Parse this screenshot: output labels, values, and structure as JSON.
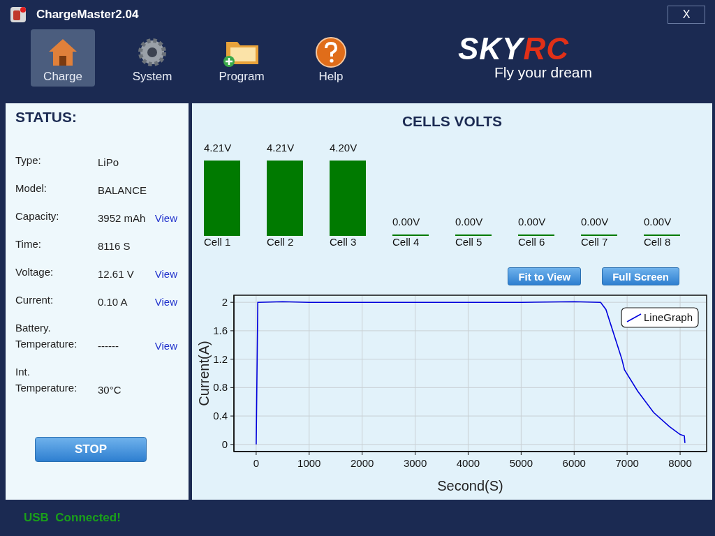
{
  "window": {
    "title": "ChargeMaster2.04",
    "close": "X"
  },
  "toolbar": [
    {
      "label": "Charge",
      "kind": "charge",
      "selected": true
    },
    {
      "label": "System",
      "kind": "system",
      "selected": false
    },
    {
      "label": "Program",
      "kind": "program",
      "selected": false
    },
    {
      "label": "Help",
      "kind": "help",
      "selected": false
    }
  ],
  "logo": {
    "primary": "SKY",
    "accent": "RC",
    "tagline": "Fly your dream"
  },
  "status": {
    "title": "STATUS:",
    "rows": [
      {
        "label": "Type:",
        "value": "LiPo"
      },
      {
        "label": "Model:",
        "value": "BALANCE"
      },
      {
        "label": "Capacity:",
        "value": "3952 mAh",
        "link": "View"
      },
      {
        "label": "Time:",
        "value": "8116 S"
      },
      {
        "label": "Voltage:",
        "value": "12.61 V",
        "link": "View"
      },
      {
        "label": "Current:",
        "value": "0.10 A",
        "link": "View"
      },
      {
        "label": "Battery.",
        "label2": "Temperature:",
        "value": "------",
        "link": "View"
      },
      {
        "label": "Int.",
        "label2": "Temperature:",
        "value": "30°C"
      }
    ],
    "stop_button": "STOP"
  },
  "cells": {
    "title": "CELLS VOLTS",
    "items": [
      {
        "name": "Cell 1",
        "reading": "4.21V",
        "kind": "full"
      },
      {
        "name": "Cell 2",
        "reading": "4.21V",
        "kind": "full"
      },
      {
        "name": "Cell 3",
        "reading": "4.20V",
        "kind": "full"
      },
      {
        "name": "Cell 4",
        "reading": "0.00V",
        "kind": "empty"
      },
      {
        "name": "Cell 5",
        "reading": "0.00V",
        "kind": "empty"
      },
      {
        "name": "Cell 6",
        "reading": "0.00V",
        "kind": "empty"
      },
      {
        "name": "Cell 7",
        "reading": "0.00V",
        "kind": "empty"
      },
      {
        "name": "Cell 8",
        "reading": "0.00V",
        "kind": "empty"
      }
    ]
  },
  "graph": {
    "buttons": [
      "Fit to View",
      "Full Screen"
    ],
    "chart_data": {
      "type": "line",
      "xlabel": "Second(S)",
      "ylabel": "Current(A)",
      "x": [
        0,
        30,
        500,
        1000,
        2000,
        3000,
        4000,
        5000,
        6000,
        6500,
        6600,
        6900,
        6950,
        7200,
        7500,
        7800,
        8000,
        8080,
        8090
      ],
      "series": [
        {
          "name": "LineGraph",
          "color": "#0000dd",
          "values": [
            0,
            2.0,
            2.01,
            2.0,
            2.0,
            2.0,
            2.0,
            2.0,
            2.01,
            2.0,
            1.9,
            1.2,
            1.05,
            0.75,
            0.45,
            0.25,
            0.14,
            0.12,
            0.02
          ]
        }
      ],
      "xlim": [
        -420,
        8500
      ],
      "ylim": [
        -0.1,
        2.1
      ],
      "xticks": [
        0,
        1000,
        2000,
        3000,
        4000,
        5000,
        6000,
        7000,
        8000
      ],
      "yticks": [
        0,
        0.4,
        0.8,
        1.2,
        1.6,
        2
      ],
      "grid": true
    }
  },
  "status_bar": "USB  Connected!"
}
